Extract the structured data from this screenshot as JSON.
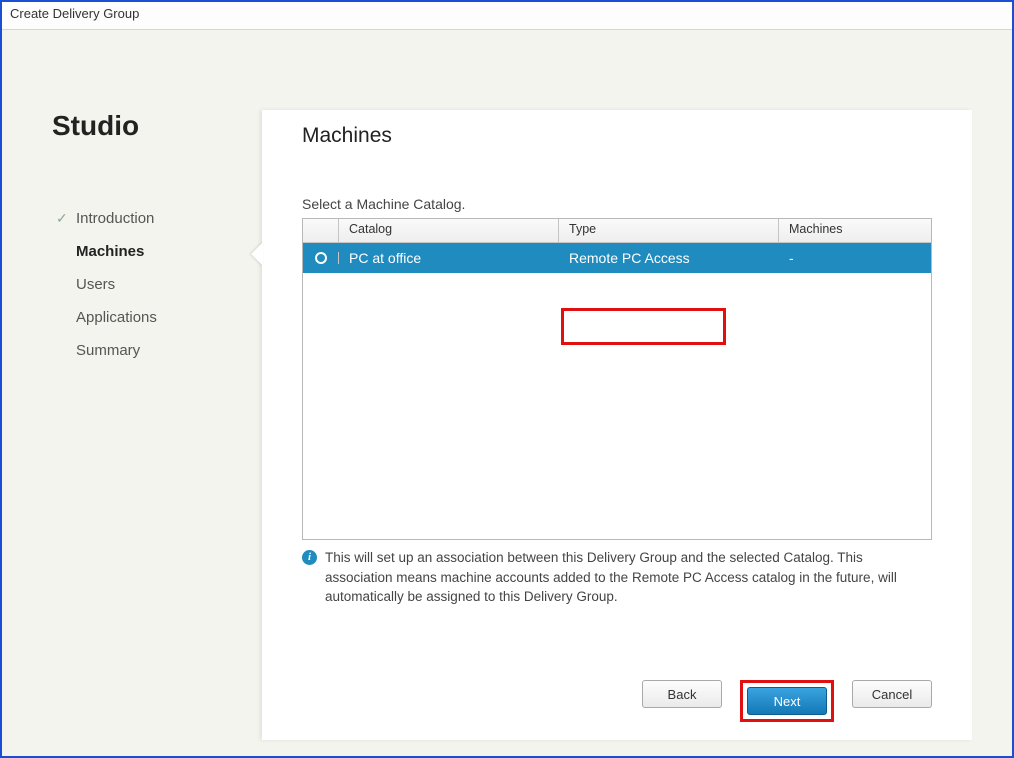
{
  "window": {
    "title": "Create Delivery Group"
  },
  "sidebar": {
    "brand": "Studio",
    "items": [
      {
        "label": "Introduction",
        "completed": true,
        "active": false
      },
      {
        "label": "Machines",
        "completed": false,
        "active": true
      },
      {
        "label": "Users",
        "completed": false,
        "active": false
      },
      {
        "label": "Applications",
        "completed": false,
        "active": false
      },
      {
        "label": "Summary",
        "completed": false,
        "active": false
      }
    ]
  },
  "main": {
    "title": "Machines",
    "instruction": "Select a Machine Catalog.",
    "table": {
      "headers": {
        "catalog": "Catalog",
        "type": "Type",
        "machines": "Machines"
      },
      "rows": [
        {
          "catalog": "PC at office",
          "type": "Remote PC Access",
          "machines": "-",
          "selected": true
        }
      ]
    },
    "info_text": "This will set up an association between this Delivery Group and the selected Catalog. This association means machine accounts added to the Remote PC Access catalog in the future, will automatically be assigned to this Delivery Group."
  },
  "footer": {
    "back": "Back",
    "next": "Next",
    "cancel": "Cancel"
  }
}
